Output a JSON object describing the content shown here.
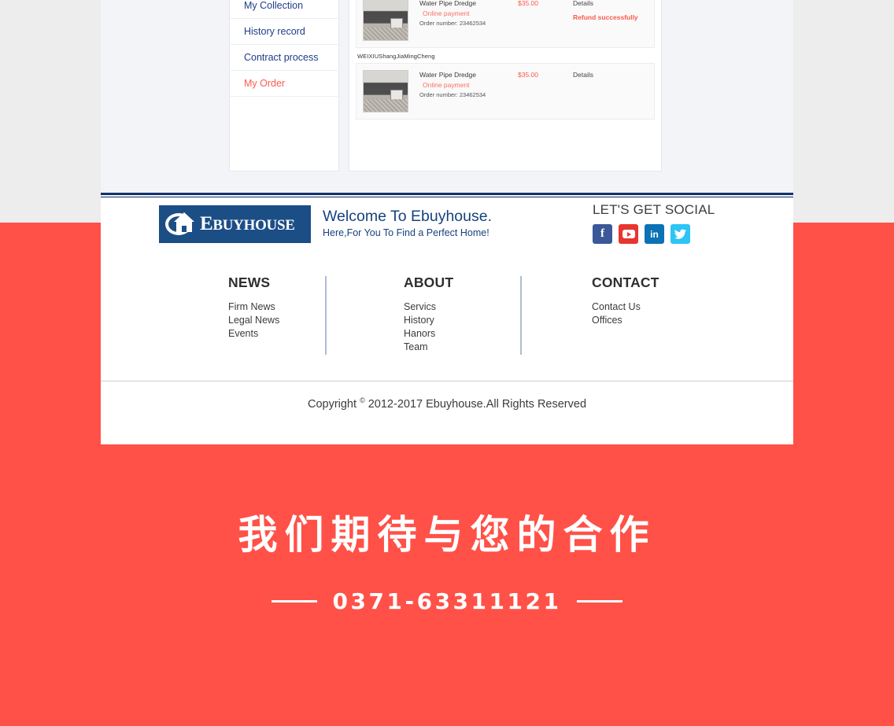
{
  "account": {
    "menu": [
      {
        "label": "My Collection",
        "active": false
      },
      {
        "label": "History record",
        "active": false
      },
      {
        "label": "Contract process",
        "active": false
      },
      {
        "label": "My Order",
        "active": true
      }
    ],
    "orders": [
      {
        "shop": "",
        "product": "Water Pipe Dredge",
        "payment": "Online payment",
        "order_number": "Order number: 23462534",
        "price": "$35.00",
        "details": "Details",
        "status": "Refund successfully"
      },
      {
        "shop": "WEIXIUShangJiaMingCheng",
        "product": "Water Pipe Dredge",
        "payment": "Online payment",
        "order_number": "Order number: 23462534",
        "price": "$35.00",
        "details": "Details",
        "status": ""
      }
    ]
  },
  "footer": {
    "logo": {
      "initial": "E",
      "word": "BUYHOUSE"
    },
    "welcome_line1": "Welcome To Ebuyhouse.",
    "welcome_line2": "Here,For You To Find a Perfect Home!",
    "social": {
      "title": "LET'S GET SOCIAL",
      "icons": [
        {
          "name": "facebook-icon",
          "glyph": "f"
        },
        {
          "name": "youtube-icon",
          "glyph": ""
        },
        {
          "name": "linkedin-icon",
          "glyph": "in"
        },
        {
          "name": "twitter-icon",
          "glyph": "✉"
        }
      ]
    },
    "columns": [
      {
        "title": "NEWS",
        "links": [
          "Firm News",
          "Legal News",
          "Events"
        ]
      },
      {
        "title": "ABOUT",
        "links": [
          "Servics",
          "History",
          "Hanors",
          "Team"
        ]
      },
      {
        "title": "CONTACT",
        "links": [
          "Contact Us",
          "Offices"
        ]
      }
    ],
    "copyright_pre": "Copyright",
    "copyright_symbol": "©",
    "copyright_post": "2012-2017 Ebuyhouse.All Rights Reserved"
  },
  "banner": {
    "title": "我们期待与您的合作",
    "phone": "0371-63311121"
  },
  "colors": {
    "brand_navy": "#1c4e86",
    "accent_red": "#fb5a4f",
    "banner_red": "#ff5148",
    "page_grey": "#ededed"
  }
}
